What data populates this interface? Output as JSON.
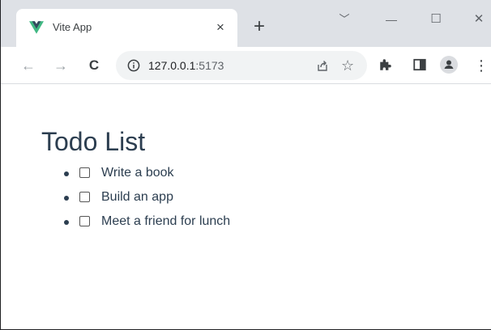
{
  "browser": {
    "tab": {
      "title": "Vite App",
      "close_symbol": "×",
      "favicon": "vue-logo-icon"
    },
    "new_tab_symbol": "+",
    "window_controls": {
      "dropdown": "﹀",
      "minimize": "—",
      "maximize": "☐",
      "close": "✕"
    },
    "toolbar": {
      "back": "←",
      "forward": "→",
      "reload": "C",
      "url_host": "127.0.0.1",
      "url_port": ":5173",
      "share_icon": "share-icon",
      "bookmark": "☆",
      "extensions_icon": "puzzle-icon",
      "sidepanel_icon": "side-panel-icon",
      "profile_icon": "profile-icon",
      "menu": "⋮"
    },
    "colors": {
      "tabstrip_bg": "#dee1e6",
      "omnibox_bg": "#f1f3f4",
      "vue_green": "#41b883",
      "vue_dark": "#34495e",
      "text": "#2c3e50"
    }
  },
  "page": {
    "heading": "Todo List",
    "todos": [
      {
        "text": "Write a book",
        "done": false
      },
      {
        "text": "Build an app",
        "done": false
      },
      {
        "text": "Meet a friend for lunch",
        "done": false
      }
    ]
  }
}
